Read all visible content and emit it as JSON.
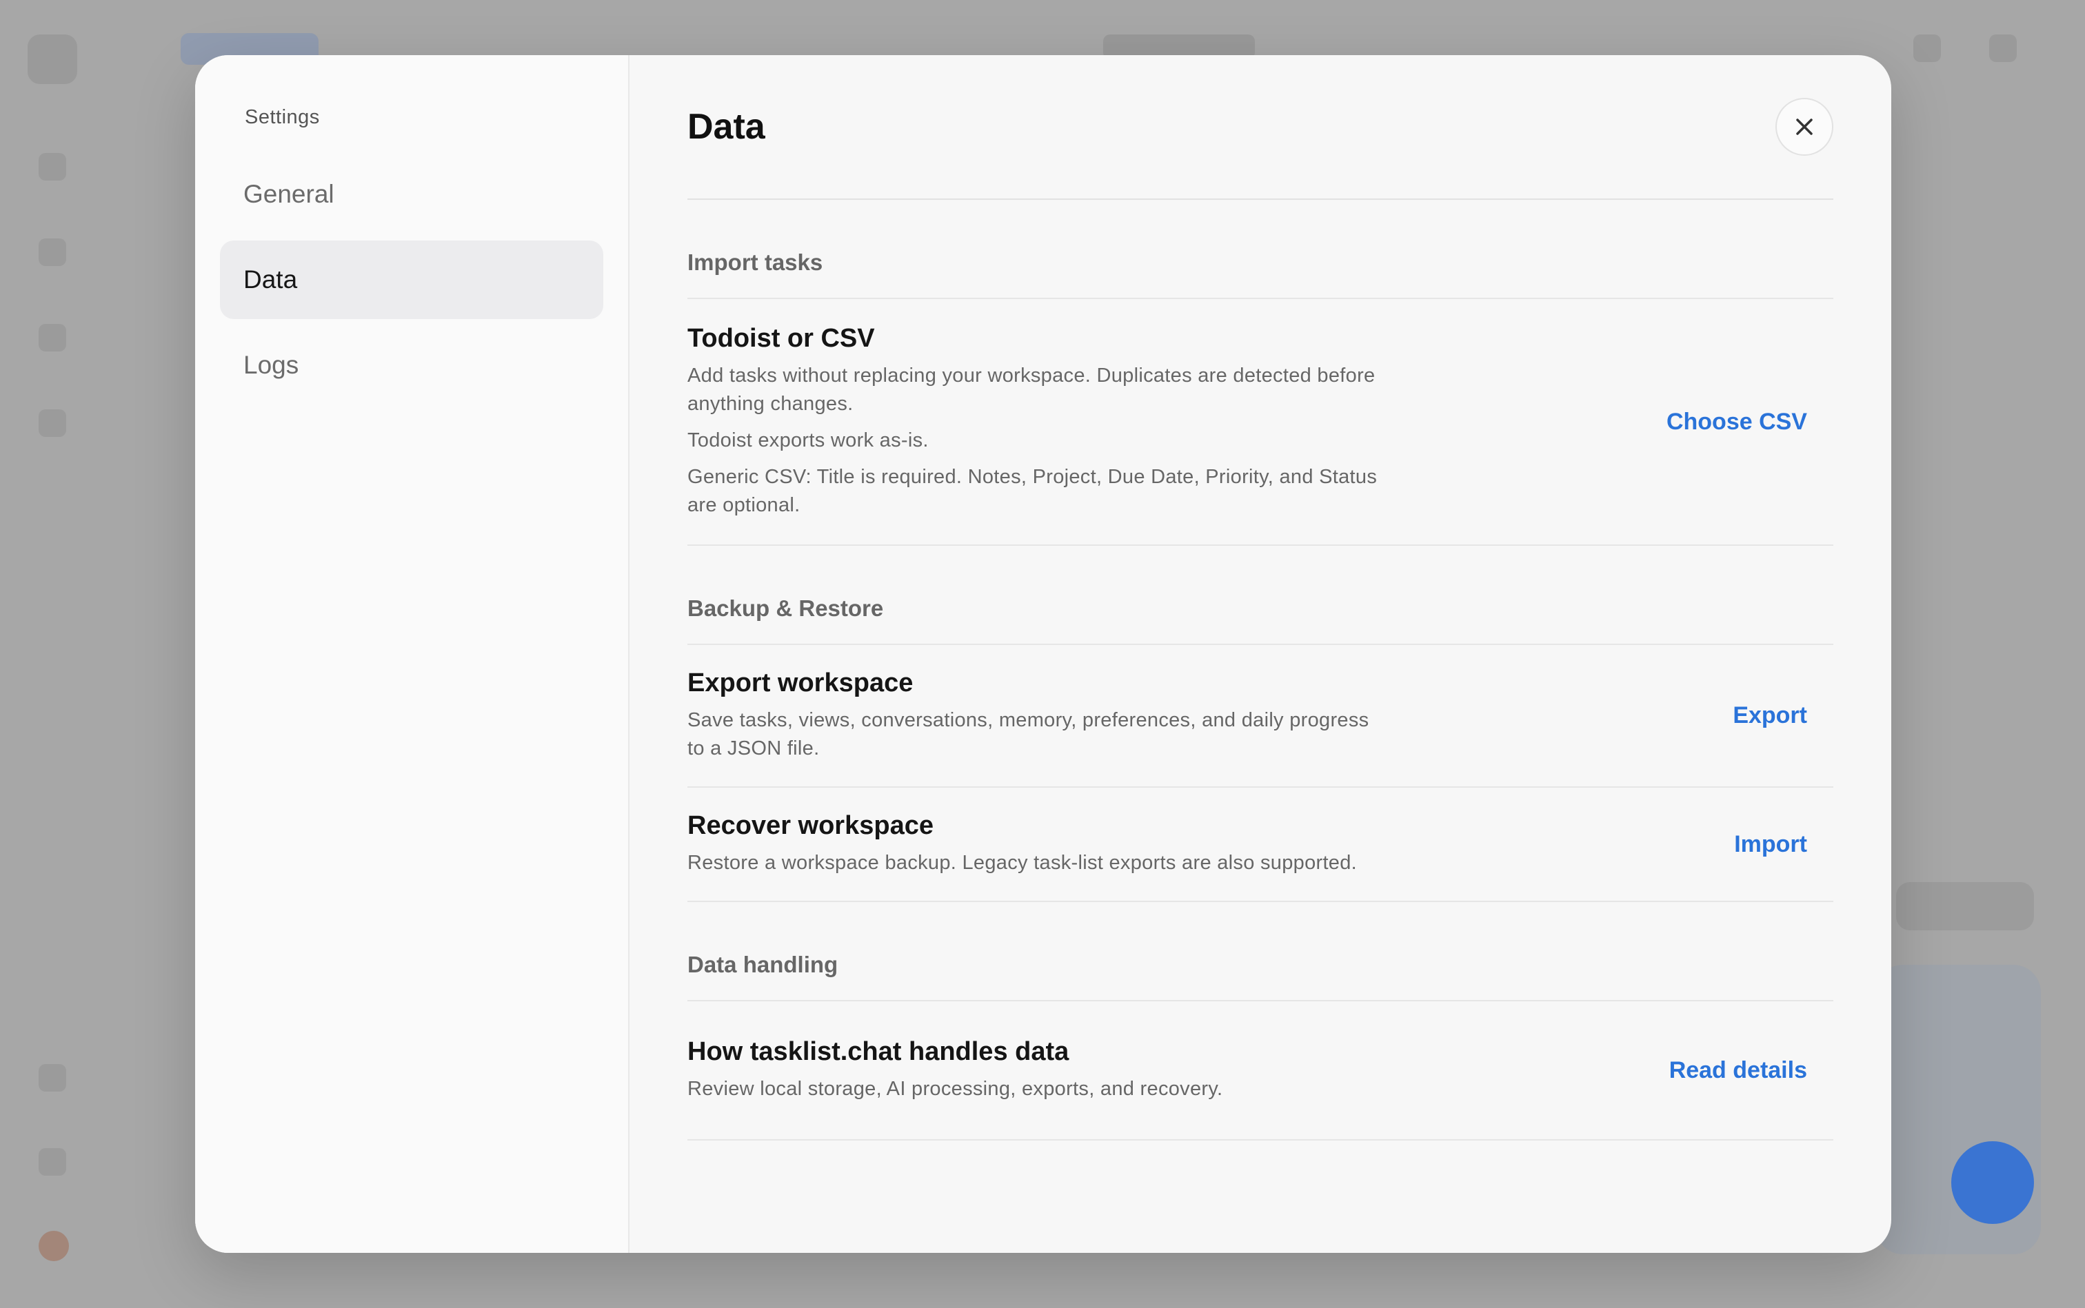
{
  "background_app": {
    "fab_color": "#2f6fd6"
  },
  "sidebar": {
    "heading": "Settings",
    "items": [
      {
        "label": "General",
        "active": false
      },
      {
        "label": "Data",
        "active": true
      },
      {
        "label": "Logs",
        "active": false
      }
    ]
  },
  "main": {
    "title": "Data",
    "close_icon": "close-icon",
    "sections": [
      {
        "title": "Import tasks",
        "rows": [
          {
            "title": "Todoist or CSV",
            "descriptions": [
              "Add tasks without replacing your workspace. Duplicates are detected before anything changes.",
              "Todoist exports work as-is.",
              "Generic CSV: Title is required. Notes, Project, Due Date, Priority, and Status are optional."
            ],
            "action": "Choose CSV"
          }
        ]
      },
      {
        "title": "Backup & Restore",
        "rows": [
          {
            "title": "Export workspace",
            "descriptions": [
              "Save tasks, views, conversations, memory, preferences, and daily progress to a JSON file."
            ],
            "action": "Export"
          },
          {
            "title": "Recover workspace",
            "descriptions": [
              "Restore a workspace backup. Legacy task-list exports are also supported."
            ],
            "action": "Import"
          }
        ]
      },
      {
        "title": "Data handling",
        "rows": [
          {
            "title": "How tasklist.chat handles data",
            "descriptions": [
              "Review local storage, AI processing, exports, and recovery."
            ],
            "action": "Read details"
          }
        ]
      }
    ]
  },
  "colors": {
    "accent": "#2a73d9",
    "active_nav_bg": "#ececee"
  }
}
